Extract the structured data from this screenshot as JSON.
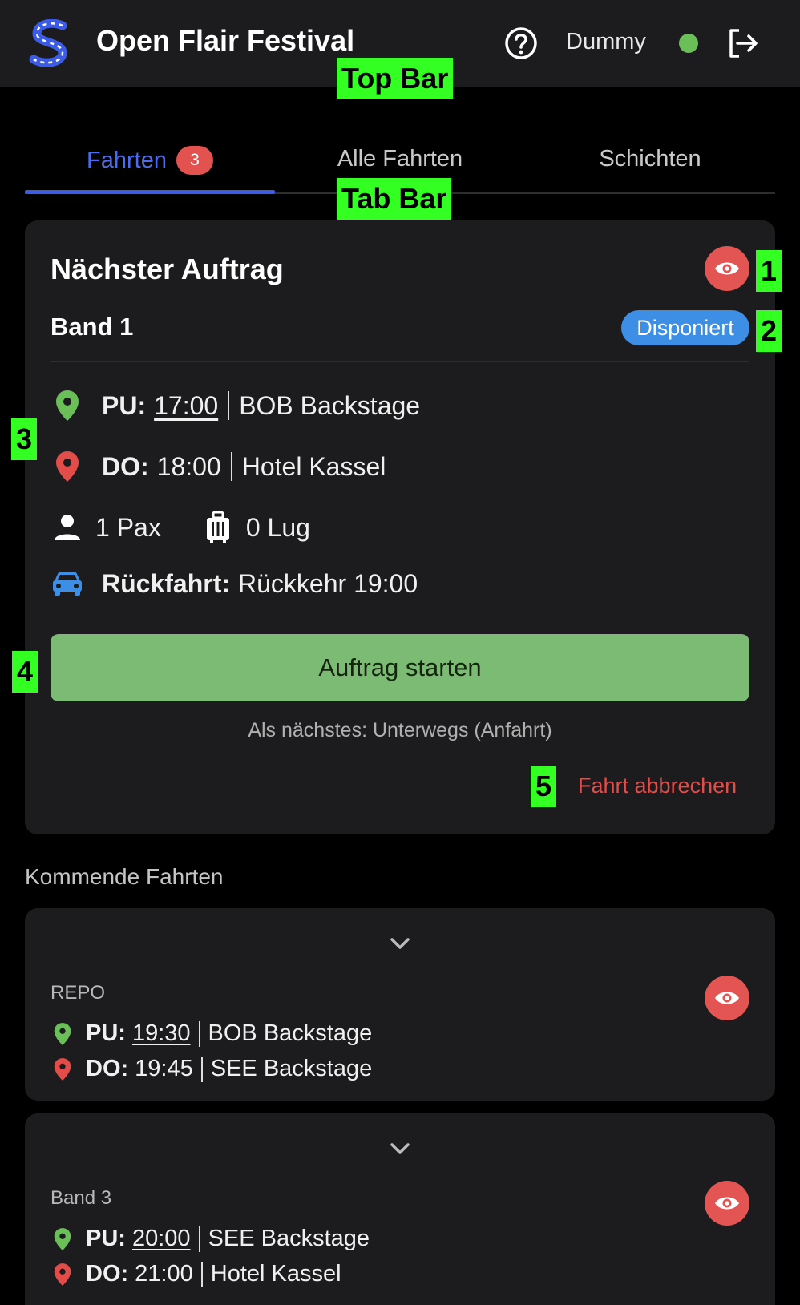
{
  "app": {
    "title": "Open Flair Festival",
    "user_name": "Dummy"
  },
  "annotations": {
    "top_bar": "Top Bar",
    "tab_bar": "Tab Bar",
    "n1": "1",
    "n2": "2",
    "n3": "3",
    "n4": "4",
    "n5": "5"
  },
  "tabs": [
    {
      "label": "Fahrten",
      "badge": "3",
      "active": true
    },
    {
      "label": "Alle Fahrten"
    },
    {
      "label": "Schichten"
    }
  ],
  "next_job": {
    "title": "Nächster Auftrag",
    "band": "Band 1",
    "status": "Disponiert",
    "pickup": {
      "label": "PU:",
      "time": "17:00",
      "place": "BOB Backstage"
    },
    "dropoff": {
      "label": "DO:",
      "time": "18:00",
      "place": "Hotel Kassel"
    },
    "pax": "1 Pax",
    "luggage": "0 Lug",
    "return_label": "Rückfahrt:",
    "return_value": "Rückkehr 19:00",
    "start_button": "Auftrag starten",
    "next_hint": "Als nächstes: Unterwegs (Anfahrt)",
    "cancel": "Fahrt abbrechen"
  },
  "upcoming": {
    "title": "Kommende Fahrten",
    "items": [
      {
        "label": "REPO",
        "pickup": {
          "label": "PU:",
          "time": "19:30",
          "place": "BOB Backstage"
        },
        "dropoff": {
          "label": "DO:",
          "time": "19:45",
          "place": "SEE Backstage"
        }
      },
      {
        "label": "Band 3",
        "pickup": {
          "label": "PU:",
          "time": "20:00",
          "place": "SEE Backstage"
        },
        "dropoff": {
          "label": "DO:",
          "time": "21:00",
          "place": "Hotel Kassel"
        }
      }
    ]
  },
  "colors": {
    "accent": "#3c5ce5",
    "danger": "#e35552",
    "success": "#7bbb73",
    "info": "#3d8fe6",
    "pin_green": "#6bbf59",
    "pin_red": "#e24d49"
  }
}
